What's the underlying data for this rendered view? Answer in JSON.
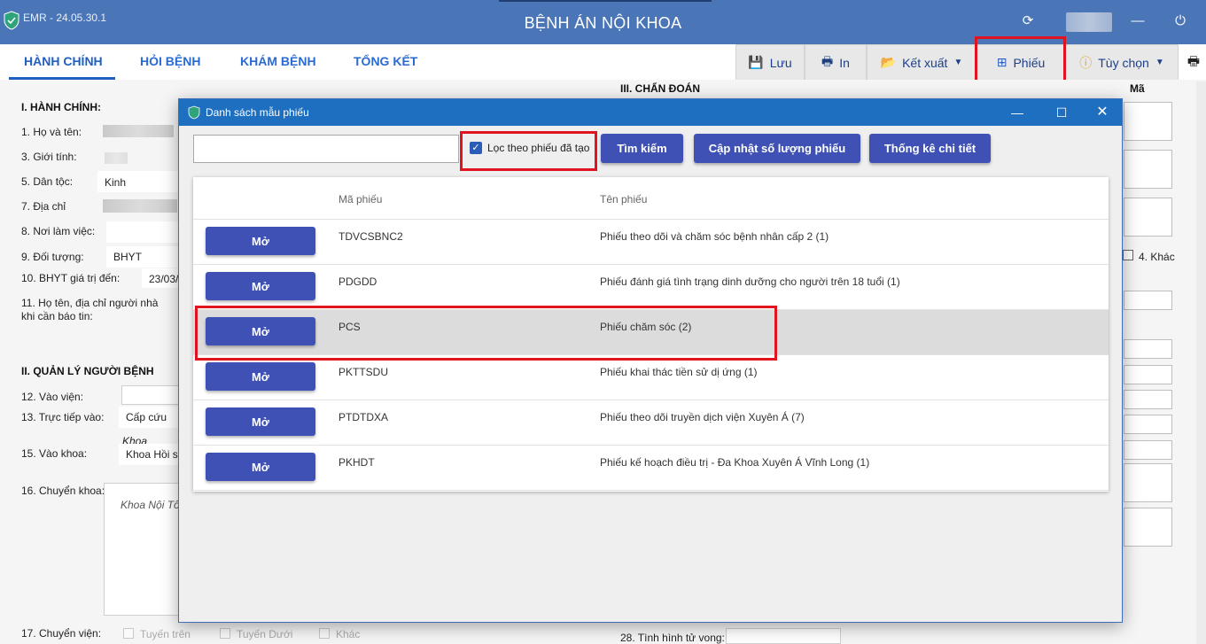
{
  "window": {
    "app_version": "EMR - 24.05.30.1",
    "title": "BỆNH ÁN NỘI KHOA",
    "icons": [
      "refresh-icon",
      "minimize-icon",
      "power-icon"
    ]
  },
  "tabs": [
    {
      "label": "HÀNH CHÍNH",
      "active": true
    },
    {
      "label": "HỎI BỆNH",
      "active": false
    },
    {
      "label": "KHÁM BỆNH",
      "active": false
    },
    {
      "label": "TỔNG KẾT",
      "active": false
    }
  ],
  "toolbar": {
    "save_label": "Lưu",
    "print_label": "In",
    "export_label": "Kết xuất",
    "form_label": "Phiếu",
    "options_label": "Tùy chọn"
  },
  "form": {
    "section1": "I. HÀNH CHÍNH:",
    "section2": "II. QUẢN LÝ NGƯỜI BỆNH",
    "section3": "III. CHẨN ĐOÁN",
    "ma_header": "Mã",
    "fields": {
      "ho_ten": "1. Họ và tên:",
      "gioi_tinh": "3. Giới tính:",
      "dan_toc": "5. Dân tộc:",
      "dan_toc_value": "Kinh",
      "dia_chi": "7. Địa chỉ",
      "noi_lam_viec": "8. Nơi làm việc:",
      "doi_tuong": "9. Đối tượng:",
      "doi_tuong_value": "BHYT",
      "bhyt": "10. BHYT giá trị đến:",
      "bhyt_value": "23/03/",
      "nguoi_nha_1": "11. Họ tên, địa chỉ người nhà",
      "nguoi_nha_2": "khi cần báo tin:",
      "vao_vien": "12. Vào viện:",
      "truc_tiep_vao": "13. Trực tiếp vào:",
      "truc_tiep_value": "Cấp cứu",
      "khoa_small": "Khoa",
      "vao_khoa": "15. Vào khoa:",
      "vao_khoa_value": "Khoa Hồi sứ",
      "chuyen_khoa": "16. Chuyển khoa:",
      "chuyen_khoa_value": "Khoa Nội Tổ",
      "chuyen_vien": "17. Chuyển viện:",
      "tuyen_tren": "Tuyến trên",
      "tuyen_duoi": "Tuyến Dưới",
      "khac": "Khác",
      "khac_4": "4. Khác",
      "tinh_hinh_tu_vong": "28. Tình hình tử vong:"
    }
  },
  "modal": {
    "title": "Danh sách mẫu phiếu",
    "search_value": "",
    "filter_label": "Lọc theo phiếu đã tạo",
    "filter_checked": true,
    "search_button": "Tìm kiếm",
    "update_button": "Cập nhật số lượng phiếu",
    "stats_button": "Thống kê chi tiết",
    "columns": {
      "code": "Mã phiếu",
      "name": "Tên phiếu"
    },
    "open_label": "Mở",
    "rows": [
      {
        "code": "TDVCSBNC2",
        "name": "Phiếu theo dõi và chăm sóc bệnh nhân cấp 2 (1)",
        "selected": false
      },
      {
        "code": "PDGDD",
        "name": "Phiếu đánh giá tình trạng dinh dưỡng cho người trên 18 tuổi (1)",
        "selected": false
      },
      {
        "code": "PCS",
        "name": "Phiếu chăm sóc (2)",
        "selected": true
      },
      {
        "code": "PKTTSDU",
        "name": "Phiếu khai thác tiền sử dị ứng (1)",
        "selected": false
      },
      {
        "code": "PTDTDXA",
        "name": "Phiếu theo dõi truyền dịch viện Xuyên Á (7)",
        "selected": false
      },
      {
        "code": "PKHDT",
        "name": "Phiếu kế hoạch điều trị - Đa Khoa Xuyên Á Vĩnh Long (1)",
        "selected": false
      }
    ]
  },
  "colors": {
    "titlebar": "#4a76b8",
    "accent": "#3f51b5",
    "tab_text": "#1f5fc2",
    "highlight": "#e0141e"
  }
}
